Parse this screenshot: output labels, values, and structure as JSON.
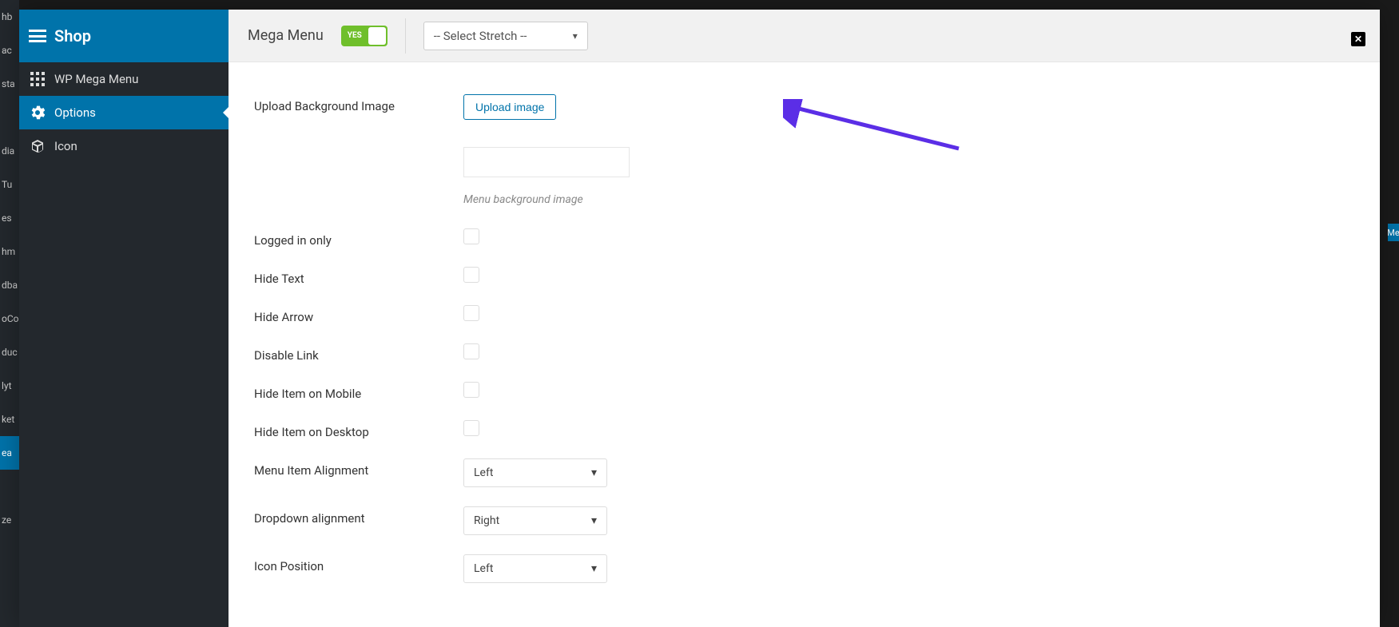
{
  "wp_admin_partial": [
    "hb",
    "ac",
    "sta",
    "",
    "dia",
    "Tu",
    "es",
    "hm",
    "dba",
    "oCo",
    "duc",
    "lyt",
    "ket",
    "ea",
    "",
    "ze"
  ],
  "sidebar": {
    "header_title": "Shop",
    "items": [
      {
        "label": "WP Mega Menu",
        "icon": "grid"
      },
      {
        "label": "Options",
        "icon": "gear"
      },
      {
        "label": "Icon",
        "icon": "cube"
      }
    ],
    "active_index": 1
  },
  "topbar": {
    "title": "Mega Menu",
    "toggle_label": "YES",
    "stretch_select": "-- Select Stretch --"
  },
  "form": {
    "upload_bg_label": "Upload Background Image",
    "upload_btn": "Upload image",
    "upload_helper": "Menu background image",
    "logged_in_label": "Logged in only",
    "hide_text_label": "Hide Text",
    "hide_arrow_label": "Hide Arrow",
    "disable_link_label": "Disable Link",
    "hide_mobile_label": "Hide Item on Mobile",
    "hide_desktop_label": "Hide Item on Desktop",
    "alignment_label": "Menu Item Alignment",
    "alignment_value": "Left",
    "dropdown_label": "Dropdown alignment",
    "dropdown_value": "Right",
    "icon_pos_label": "Icon Position",
    "icon_pos_value": "Left"
  },
  "right_edge_text": "Me"
}
